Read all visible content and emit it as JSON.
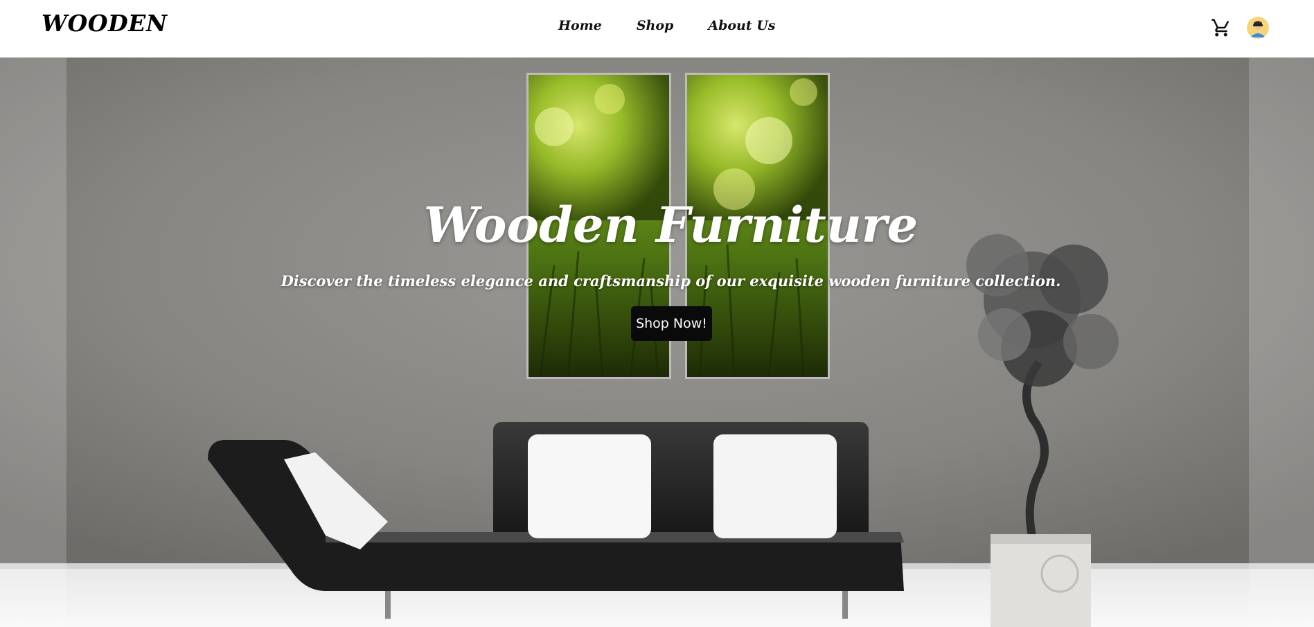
{
  "brand": {
    "logo_text": "WOODEN"
  },
  "nav": {
    "links": [
      {
        "label": "Home"
      },
      {
        "label": "Shop"
      },
      {
        "label": "About Us"
      }
    ],
    "cart_icon": "cart-icon",
    "avatar_icon": "user-avatar"
  },
  "hero": {
    "title": "Wooden Furniture",
    "subtitle": "Discover the timeless elegance and craftsmanship of our exquisite wooden furniture collection.",
    "cta_label": "Shop Now!"
  },
  "colors": {
    "navbar_bg": "#ffffff",
    "button_bg": "#0a0a0a",
    "hero_text": "#ffffff"
  }
}
